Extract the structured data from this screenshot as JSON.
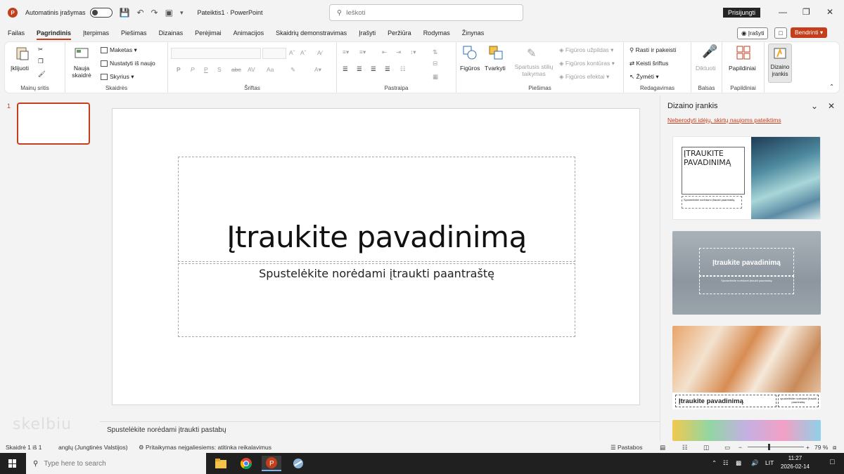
{
  "titlebar": {
    "app_logo": "P",
    "autosave_label": "Automatinis įrašymas",
    "doc_title": "Pateiktis1 · PowerPoint",
    "search_placeholder": "Ieškoti",
    "signin_label": "Prisijungti"
  },
  "menu": {
    "tabs": [
      "Failas",
      "Pagrindinis",
      "Įterpimas",
      "Piešimas",
      "Dizainas",
      "Perėjimai",
      "Animacijos",
      "Skaidrių demonstravimas",
      "Įrašyti",
      "Peržiūra",
      "Rodymas",
      "Žinynas"
    ],
    "active_tab": "Pagrindinis",
    "record_label": "Įrašyti",
    "share_label": "Bendrinti"
  },
  "ribbon": {
    "clipboard": {
      "paste_label": "Įklijuoti",
      "group_label": "Mainų sritis"
    },
    "slides": {
      "new_slide_label": "Nauja skaidrė",
      "layout_label": "Maketas",
      "reset_label": "Nustatyti iš naujo",
      "section_label": "Skyrius",
      "group_label": "Skaidrės"
    },
    "font": {
      "bold": "P",
      "italic": "P",
      "underline": "P",
      "strike": "S",
      "spacing": "AV",
      "group_label": "Šriftas"
    },
    "paragraph": {
      "group_label": "Pastraipa"
    },
    "drawing": {
      "shapes_label": "Figūros",
      "arrange_label": "Tvarkyti",
      "quick_styles_label": "Spartusis stilių taikymas",
      "shape_fill": "Figūros užpildas",
      "shape_outline": "Figūros kontūras",
      "shape_effects": "Figūros efektai",
      "group_label": "Piešimas"
    },
    "editing": {
      "find_label": "Rasti ir pakeisti",
      "replace_fonts_label": "Keisti šriftus",
      "select_label": "Žymėti",
      "group_label": "Redagavimas"
    },
    "voice": {
      "dictate_label": "Diktuoti",
      "group_label": "Balsas"
    },
    "addins": {
      "addins_label": "Papildiniai",
      "group_label": "Papildiniai"
    },
    "designer": {
      "designer_label": "Dizaino įrankis"
    }
  },
  "thumbnails": {
    "slide_number": "1"
  },
  "slide": {
    "title_placeholder": "Įtraukite pavadinimą",
    "subtitle_placeholder": "Spustelėkite norėdami įtraukti paantraštę"
  },
  "notes": {
    "placeholder": "Spustelėkite norėdami įtraukti pastabų"
  },
  "watermark": "skelbiu",
  "designer_pane": {
    "title": "Dizaino įrankis",
    "link": "Neberodyti idėjų, skirtų naujoms pateiktims",
    "design1": {
      "title": "ĮTRAUKITE PAVADINIMĄ",
      "subtitle": "Spustelėkite norėdami įtraukti paantraštę"
    },
    "design2": {
      "title": "Įtraukite pavadinimą",
      "subtitle": "Spustelėkite norėdami įtraukti paantraštę"
    },
    "design3": {
      "title": "Įtraukite pavadinimą",
      "subtitle": "spustelėkite norėdami įtraukti paantraštę"
    }
  },
  "statusbar": {
    "slide_count": "Skaidrė 1 iš 1",
    "language": "anglų (Jungtinės Valstijos)",
    "accessibility": "Pritaikymas neįgaliesiems: atitinka reikalavimus",
    "notes_label": "Pastabos",
    "zoom_level": "79 %"
  },
  "taskbar": {
    "search_placeholder": "Type here to search",
    "language": "LIT",
    "time": "11:27",
    "date": "2026-02-14"
  }
}
